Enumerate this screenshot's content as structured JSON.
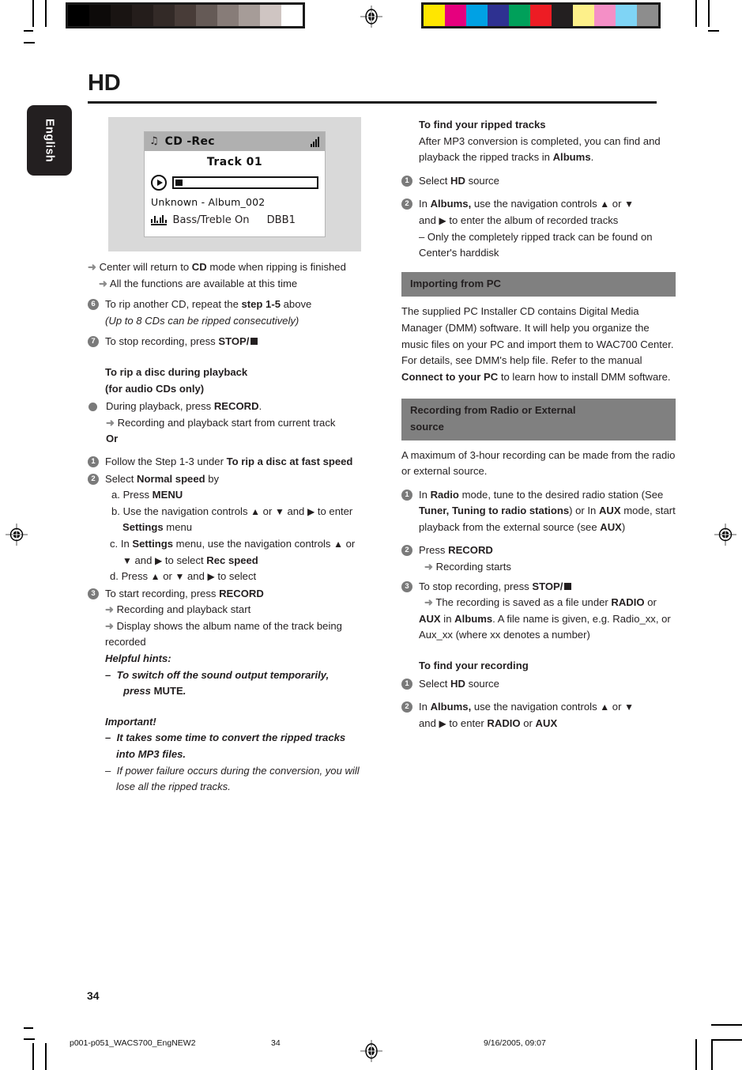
{
  "meta": {
    "chapter_title": "HD",
    "language_tab": "English",
    "page_number": "34"
  },
  "footer": {
    "file": "p001-p051_WACS700_EngNEW2",
    "page": "34",
    "timestamp": "9/16/2005, 09:07"
  },
  "colors": {
    "section_heading_bg": "#808080",
    "bullet_gray": "#7a7a7a",
    "lcd_header_bg": "#b0b0b0",
    "lcd_frame_bg": "#d9d9d9",
    "ink": "#231f20"
  },
  "calibration": {
    "gray_ramp": [
      "#000000",
      "#0d0a09",
      "#191412",
      "#241d1b",
      "#332a27",
      "#483c38",
      "#655a56",
      "#877c78",
      "#a69c98",
      "#cfc5c2",
      "#ffffff"
    ],
    "cmyk_bars": [
      "#ffe600",
      "#e6007e",
      "#00a1e4",
      "#2e3191",
      "#00a05a",
      "#ed1c24",
      "#231f20",
      "#fdf08a",
      "#f48fc6",
      "#7fd4f5",
      "#8d8d8d"
    ]
  },
  "lcd": {
    "mode_label": "CD -Rec",
    "note_icon": "music-note-icon",
    "signal_icon": "signal-strength-icon",
    "track": "Track 01",
    "play_icon": "play-icon",
    "album": "Unknown - Album_002",
    "eq_icon": "equalizer-icon",
    "bass": "Bass/Treble On",
    "dbb": "DBB1"
  },
  "left_column": {
    "notes_top": [
      {
        "marker": "arrow",
        "text_a": "Center will return to ",
        "bold": "CD",
        "text_b": " mode when ripping is finished"
      },
      {
        "marker": "arrow",
        "text_a": "All the functions are available at this time",
        "bold": "",
        "text_b": ""
      }
    ],
    "step6": {
      "num": "6",
      "text_a": "To rip another CD, repeat the ",
      "bold": "step 1-5",
      "text_b": " above",
      "italic_note": "(Up to 8 CDs can be ripped consecutively)"
    },
    "step7": {
      "num": "7",
      "text_a": "To stop recording, press ",
      "bold": "STOP/",
      "stop_icon": "stop-square-icon"
    },
    "heading_rip_playback_line1": "To rip a disc during playback",
    "heading_rip_playback_line2": "(for audio CDs only)",
    "bullet_during_playback": {
      "text_a": "During playback, press ",
      "bold": "RECORD",
      "text_b": ".",
      "arrow_line": "Recording and playback start from current track",
      "or_label": "Or"
    },
    "step1": {
      "num": "1",
      "text_a": "Follow the Step 1-3 under ",
      "bold": "To rip a disc at fast speed"
    },
    "step2": {
      "num": "2",
      "text_a": "Select ",
      "bold": "Normal speed",
      "text_b": " by",
      "sub_a": {
        "label": "a.",
        "text_a": "Press ",
        "bold": "MENU"
      },
      "sub_b": {
        "label": "b.",
        "text_a": "Use the navigation controls ",
        "nav1": "▲",
        "mid": " or ",
        "nav2": "▼",
        "and": " and ",
        "nav3": "▶",
        "text_b": " to enter ",
        "bold": "Settings",
        "text_c": " menu"
      },
      "sub_c": {
        "label": "c.",
        "text_a": "In ",
        "bold1": "Settings",
        "text_b": " menu,  use the navigation controls ",
        "nav1": "▲",
        "mid": " or ",
        "nav2": "▼",
        "and": " and ",
        "nav3": "▶",
        "text_c": " to select ",
        "bold2": "Rec speed"
      },
      "sub_d": {
        "label": "d.",
        "text_a": "Press ",
        "nav1": "▲",
        "mid": " or ",
        "nav2": "▼",
        "and": " and ",
        "nav3": "▶",
        "text_b": " to select"
      }
    },
    "step3": {
      "num": "3",
      "text_a": "To start recording, press ",
      "bold": "RECORD",
      "arrow1": "Recording and playback start",
      "arrow2": "Display shows the album name of the track being recorded"
    },
    "helpful_hints": {
      "title": "Helpful hints:",
      "item_a": "To switch off the sound output temporarily,",
      "item_b_pre": "press ",
      "item_b_bold": "MUTE",
      "item_b_post": "."
    },
    "important": {
      "title": "Important!",
      "item1": "It takes some time to convert the ripped tracks into MP3 files.",
      "item2": "If power failure occurs during the conversion, you will lose all the ripped tracks."
    }
  },
  "right_column": {
    "heading_find_ripped": "To find your ripped tracks",
    "find_ripped_intro_a": "After MP3 conversion is completed, you can find and playback the ripped tracks in ",
    "find_ripped_intro_bold": "Albums",
    "find_ripped_intro_b": ".",
    "r_step1": {
      "num": "1",
      "text_a": "Select ",
      "bold": "HD",
      "text_b": " source"
    },
    "r_step2": {
      "num": "2",
      "text_a": "In ",
      "bold": "Albums,",
      "text_b": " use the navigation controls ",
      "nav1": "▲",
      "mid": " or ",
      "nav2": "▼",
      "line2_a": "and ",
      "nav3": "▶",
      "line2_b": " to enter the album of recorded tracks",
      "dash": "–  Only the completely ripped track can be found on Center's harddisk"
    },
    "sec_importing": "Importing from PC",
    "importing_body_a": "The supplied PC Installer CD contains Digital Media Manager (DMM) software.  It will help you organize the music files on your PC  and import them to WAC700 Center.  For details, see DMM's help file. Refer to the manual ",
    "importing_body_bold": "Connect to your PC",
    "importing_body_b": " to learn how to install DMM software.",
    "sec_recording_line1": "Recording from Radio or External",
    "sec_recording_line2": "source",
    "recording_intro": "A maximum of 3-hour recording can be made from the radio or external source.",
    "rec_step1": {
      "num": "1",
      "text_a": "In ",
      "bold1": "Radio",
      "text_b": " mode, tune to the desired radio station (See ",
      "bold2": "Tuner, Tuning to radio stations",
      "text_c": ") or In ",
      "bold3": "AUX",
      "text_d": " mode, start playback from the external source (see ",
      "bold4": "AUX",
      "text_e": ")"
    },
    "rec_step2": {
      "num": "2",
      "text_a": "Press ",
      "bold": "RECORD",
      "arrow": "Recording starts"
    },
    "rec_step3": {
      "num": "3",
      "text_a": "To stop recording,  press ",
      "bold": "STOP/",
      "stop_icon": "stop-square-icon",
      "arrow_a": "The recording is saved as a file under ",
      "arrow_bold1": "RADIO",
      "arrow_b": " or ",
      "arrow_bold2": "AUX",
      "arrow_c": " in ",
      "arrow_bold3": "Albums",
      "arrow_d": ". A file name is given, e.g. Radio_xx, or  Aux_xx (where xx denotes a number)"
    },
    "heading_find_recording": "To find your recording",
    "f_step1": {
      "num": "1",
      "text_a": "Select ",
      "bold": "HD",
      "text_b": " source"
    },
    "f_step2": {
      "num": "2",
      "text_a": "In ",
      "bold": "Albums,",
      "text_b": " use the navigation controls ",
      "nav1": "▲",
      "mid": " or ",
      "nav2": "▼",
      "line2_a": "and ",
      "nav3": "▶",
      "line2_b": " to enter ",
      "bold2": "RADIO",
      "line2_c": " or ",
      "bold3": "AUX"
    }
  }
}
